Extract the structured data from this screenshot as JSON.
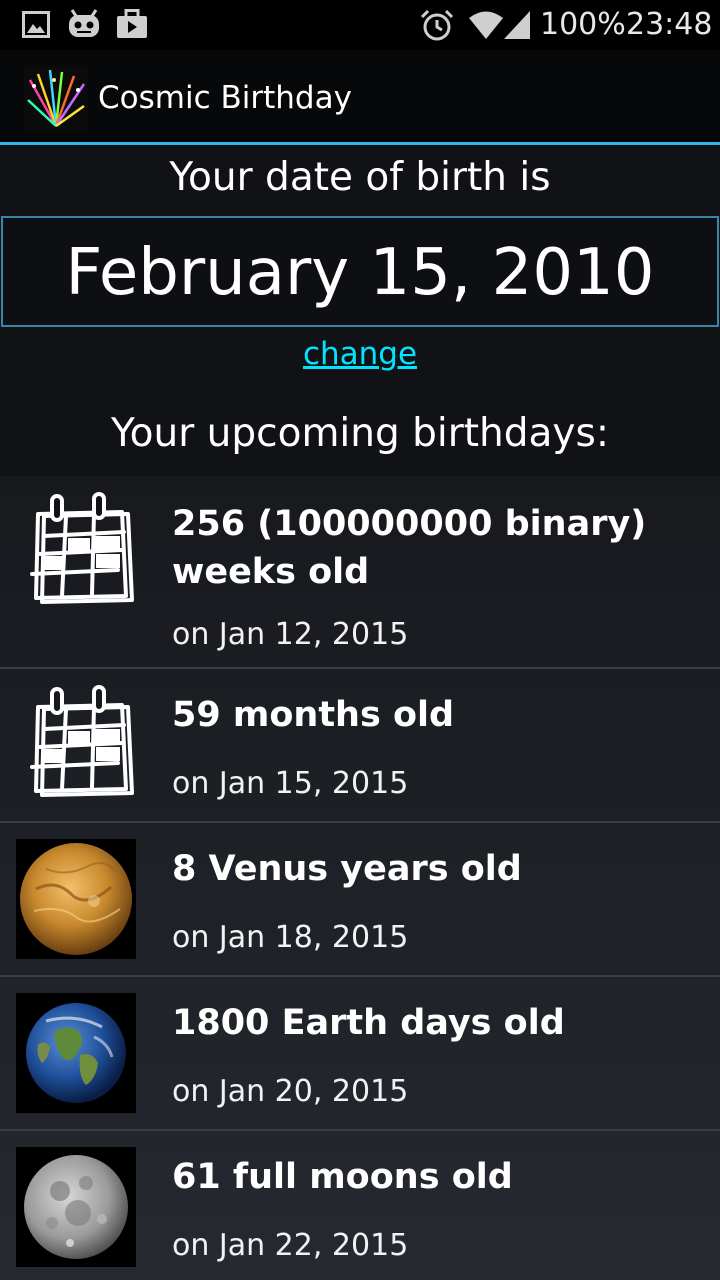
{
  "status_bar": {
    "battery": "100%",
    "time": "23:48",
    "icons": [
      "image-icon",
      "android-icon",
      "briefcase-icon",
      "alarm-icon",
      "wifi-icon",
      "signal-icon"
    ]
  },
  "app": {
    "title": "Cosmic Birthday",
    "accent_color": "#33b5e5",
    "link_color": "#00e5ff"
  },
  "header": {
    "dob_label": "Your date of birth is",
    "dob_value": "February 15, 2010",
    "change_link": "change",
    "upcoming_label": "Your upcoming birthdays:"
  },
  "birthdays": [
    {
      "icon": "calendar-icon",
      "title": "256 (100000000 binary) weeks old",
      "date": "on Jan 12, 2015"
    },
    {
      "icon": "calendar-icon",
      "title": "59 months old",
      "date": "on Jan 15, 2015"
    },
    {
      "icon": "venus-icon",
      "title": "8 Venus years old",
      "date": "on Jan 18, 2015"
    },
    {
      "icon": "earth-icon",
      "title": "1800 Earth days old",
      "date": "on Jan 20, 2015"
    },
    {
      "icon": "moon-icon",
      "title": "61 full moons old",
      "date": "on Jan 22, 2015"
    }
  ]
}
